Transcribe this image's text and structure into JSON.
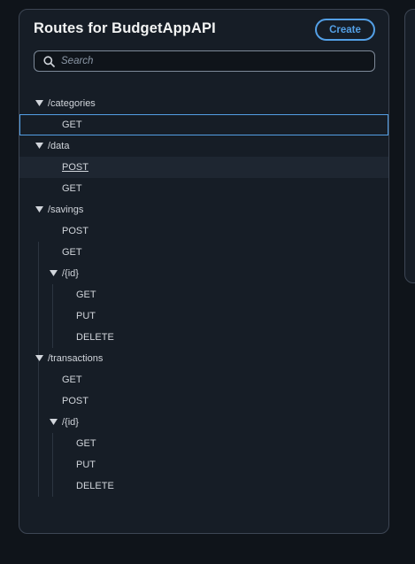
{
  "panel": {
    "title": "Routes for BudgetAppAPI",
    "create_label": "Create",
    "search_placeholder": "Search"
  },
  "colors": {
    "accent": "#539fe5",
    "panel_bg": "#161d26",
    "border": "#3d4654",
    "text": "#d1d5db",
    "title": "#f2f3f3"
  },
  "icons": {
    "search": "search-icon",
    "expand": "caret-down-icon"
  },
  "routes": [
    {
      "label": "/categories",
      "kind": "resource",
      "expanded": true
    },
    {
      "label": "GET",
      "kind": "method",
      "selected": true
    },
    {
      "label": "/data",
      "kind": "resource",
      "expanded": true
    },
    {
      "label": "POST",
      "kind": "method",
      "hovered": true
    },
    {
      "label": "GET",
      "kind": "method"
    },
    {
      "label": "/savings",
      "kind": "resource",
      "expanded": true
    },
    {
      "label": "POST",
      "kind": "method"
    },
    {
      "label": "GET",
      "kind": "method"
    },
    {
      "label": "/{id}",
      "kind": "resource",
      "expanded": true
    },
    {
      "label": "GET",
      "kind": "method"
    },
    {
      "label": "PUT",
      "kind": "method"
    },
    {
      "label": "DELETE",
      "kind": "method"
    },
    {
      "label": "/transactions",
      "kind": "resource",
      "expanded": true
    },
    {
      "label": "GET",
      "kind": "method"
    },
    {
      "label": "POST",
      "kind": "method"
    },
    {
      "label": "/{id}",
      "kind": "resource",
      "expanded": true
    },
    {
      "label": "GET",
      "kind": "method"
    },
    {
      "label": "PUT",
      "kind": "method"
    },
    {
      "label": "DELETE",
      "kind": "method"
    }
  ]
}
